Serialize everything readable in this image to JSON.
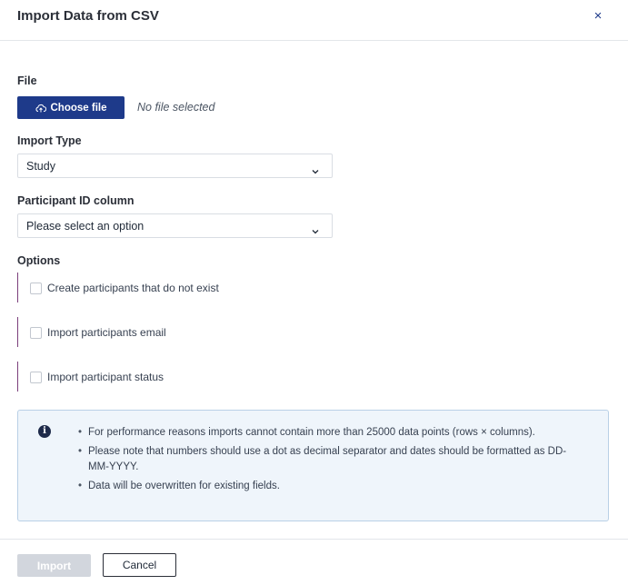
{
  "dialog": {
    "title": "Import Data from CSV",
    "close_glyph": "×"
  },
  "file": {
    "label": "File",
    "choose_button": "Choose file",
    "choose_icon": "cloud-upload-icon",
    "status": "No file selected"
  },
  "import_type": {
    "label": "Import Type",
    "selected": "Study"
  },
  "participant_id": {
    "label": "Participant ID column",
    "selected": "Please select an option"
  },
  "options": {
    "label": "Options",
    "items": [
      {
        "label": "Create participants that do not exist",
        "checked": false
      },
      {
        "label": "Import participants email",
        "checked": false
      },
      {
        "label": "Import participant status",
        "checked": false
      }
    ]
  },
  "info": {
    "icon": "info-icon",
    "bullets": [
      "For performance reasons imports cannot contain more than 25000 data points (rows × columns).",
      "Please note that numbers should use a dot as decimal separator and dates should be formatted as DD-MM-YYYY.",
      "Data will be overwritten for existing fields."
    ]
  },
  "footer": {
    "import_button": "Import",
    "cancel_button": "Cancel"
  },
  "colors": {
    "primary": "#1e3a8a",
    "option_accent": "#7b3f7b",
    "info_background": "#eff5fb",
    "disabled_button": "#d2d6dd"
  }
}
